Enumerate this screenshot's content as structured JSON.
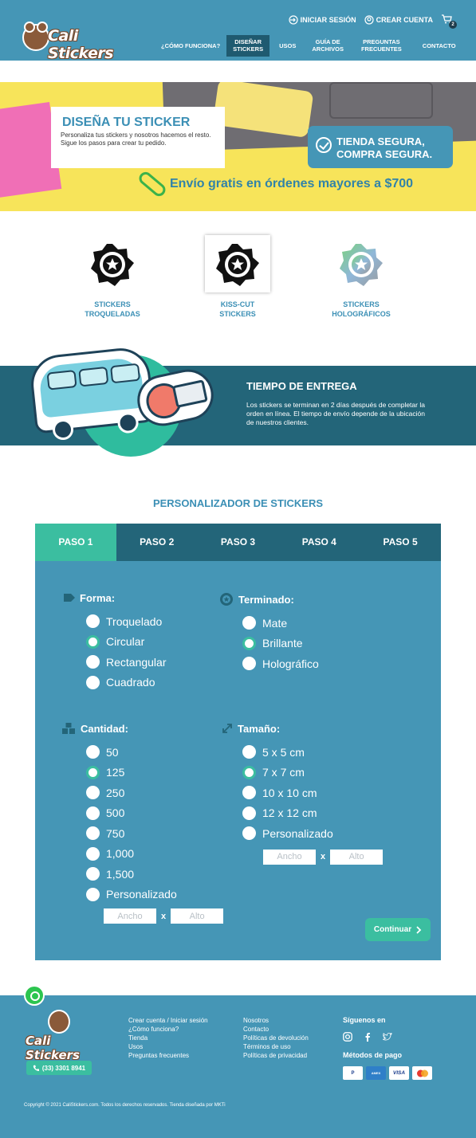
{
  "header": {
    "logo_text": "Cali Stickers",
    "login_label": "INICIAR SESIÓN",
    "signup_label": "CREAR CUENTA",
    "cart_count": "2",
    "nav": [
      {
        "label": "¿CÓMO FUNCIONA?"
      },
      {
        "label": "DISEÑAR\nSTICKERS"
      },
      {
        "label": "USOS"
      },
      {
        "label": "GUÍA DE\nARCHIVOS"
      },
      {
        "label": "PREGUNTAS\nFRECUENTES"
      },
      {
        "label": "CONTACTO"
      }
    ],
    "active_nav": "DISEÑAR STICKERS"
  },
  "hero": {
    "title": "DISEÑA TU STICKER",
    "text": "Personaliza tus stickers y nosotros hacemos el resto. Sigue los pasos para crear tu pedido.",
    "secure_line1": "TIENDA SEGURA,",
    "secure_line2": "COMPRA SEGURA.",
    "shipping": "Envío gratis en órdenes mayores a $700"
  },
  "sticker_types": [
    {
      "label": "STICKERS\nTROQUELADAS",
      "icon": "badge-star-icon"
    },
    {
      "label": "KISS-CUT\nSTICKERS",
      "icon": "badge-star-icon"
    },
    {
      "label": "STICKERS\nHOLOGRÁFICOS",
      "icon": "holographic-badge-icon"
    }
  ],
  "delivery": {
    "title": "TIEMPO DE ENTREGA",
    "text": "Los stickers se terminan en 2 días después de completar la orden en línea. El tiempo de envío depende de la ubicación de nuestros clientes."
  },
  "personalizer": {
    "title": "PERSONALIZADOR DE STICKERS",
    "steps": [
      "PASO 1",
      "PASO 2",
      "PASO 3",
      "PASO 4",
      "PASO 5"
    ],
    "active_step": "PASO 1",
    "forma": {
      "label": "Forma:",
      "options": [
        "Troquelado",
        "Circular",
        "Rectangular",
        "Cuadrado"
      ],
      "selected": "Circular"
    },
    "terminado": {
      "label": "Terminado:",
      "options": [
        "Mate",
        "Brillante",
        "Holográfico"
      ],
      "selected": "Brillante"
    },
    "cantidad": {
      "label": "Cantidad:",
      "options": [
        "50",
        "125",
        "250",
        "500",
        "750",
        "1,000",
        "1,500",
        "Personalizado"
      ],
      "selected": "125"
    },
    "tamano": {
      "label": "Tamaño:",
      "options": [
        "5 x 5 cm",
        "7 x 7 cm",
        "10 x 10 cm",
        "12 x 12 cm",
        "Personalizado"
      ],
      "selected": "7 x 7 cm"
    },
    "width_placeholder": "Ancho",
    "height_placeholder": "Alto",
    "times": "x",
    "continue_label": "Continuar"
  },
  "footer": {
    "logo_text": "Cali Stickers",
    "phone": "(33) 3301 8941",
    "col1": [
      "Crear cuenta / Iniciar sesión",
      "¿Cómo funciona?",
      "Tienda",
      "Usos",
      "Preguntas frecuentes"
    ],
    "col2": [
      "Nosotros",
      "Contacto",
      "Políticas de devolución",
      "Términos de uso",
      "Políticas de privacidad"
    ],
    "follow_label": "Síguenos en",
    "payment_label": "Métodos de pago",
    "payment_methods": [
      "PayPal",
      "American Express",
      "VISA",
      "Mastercard"
    ],
    "copyright": "Copyright © 2021 CaliStickers.com. Todos los derechos reservados. Tienda diseñada por MKTi"
  },
  "colors": {
    "primary": "#4596b6",
    "dark": "#236579",
    "accent": "#3bbea0",
    "hero_yellow": "#f7e45a"
  }
}
